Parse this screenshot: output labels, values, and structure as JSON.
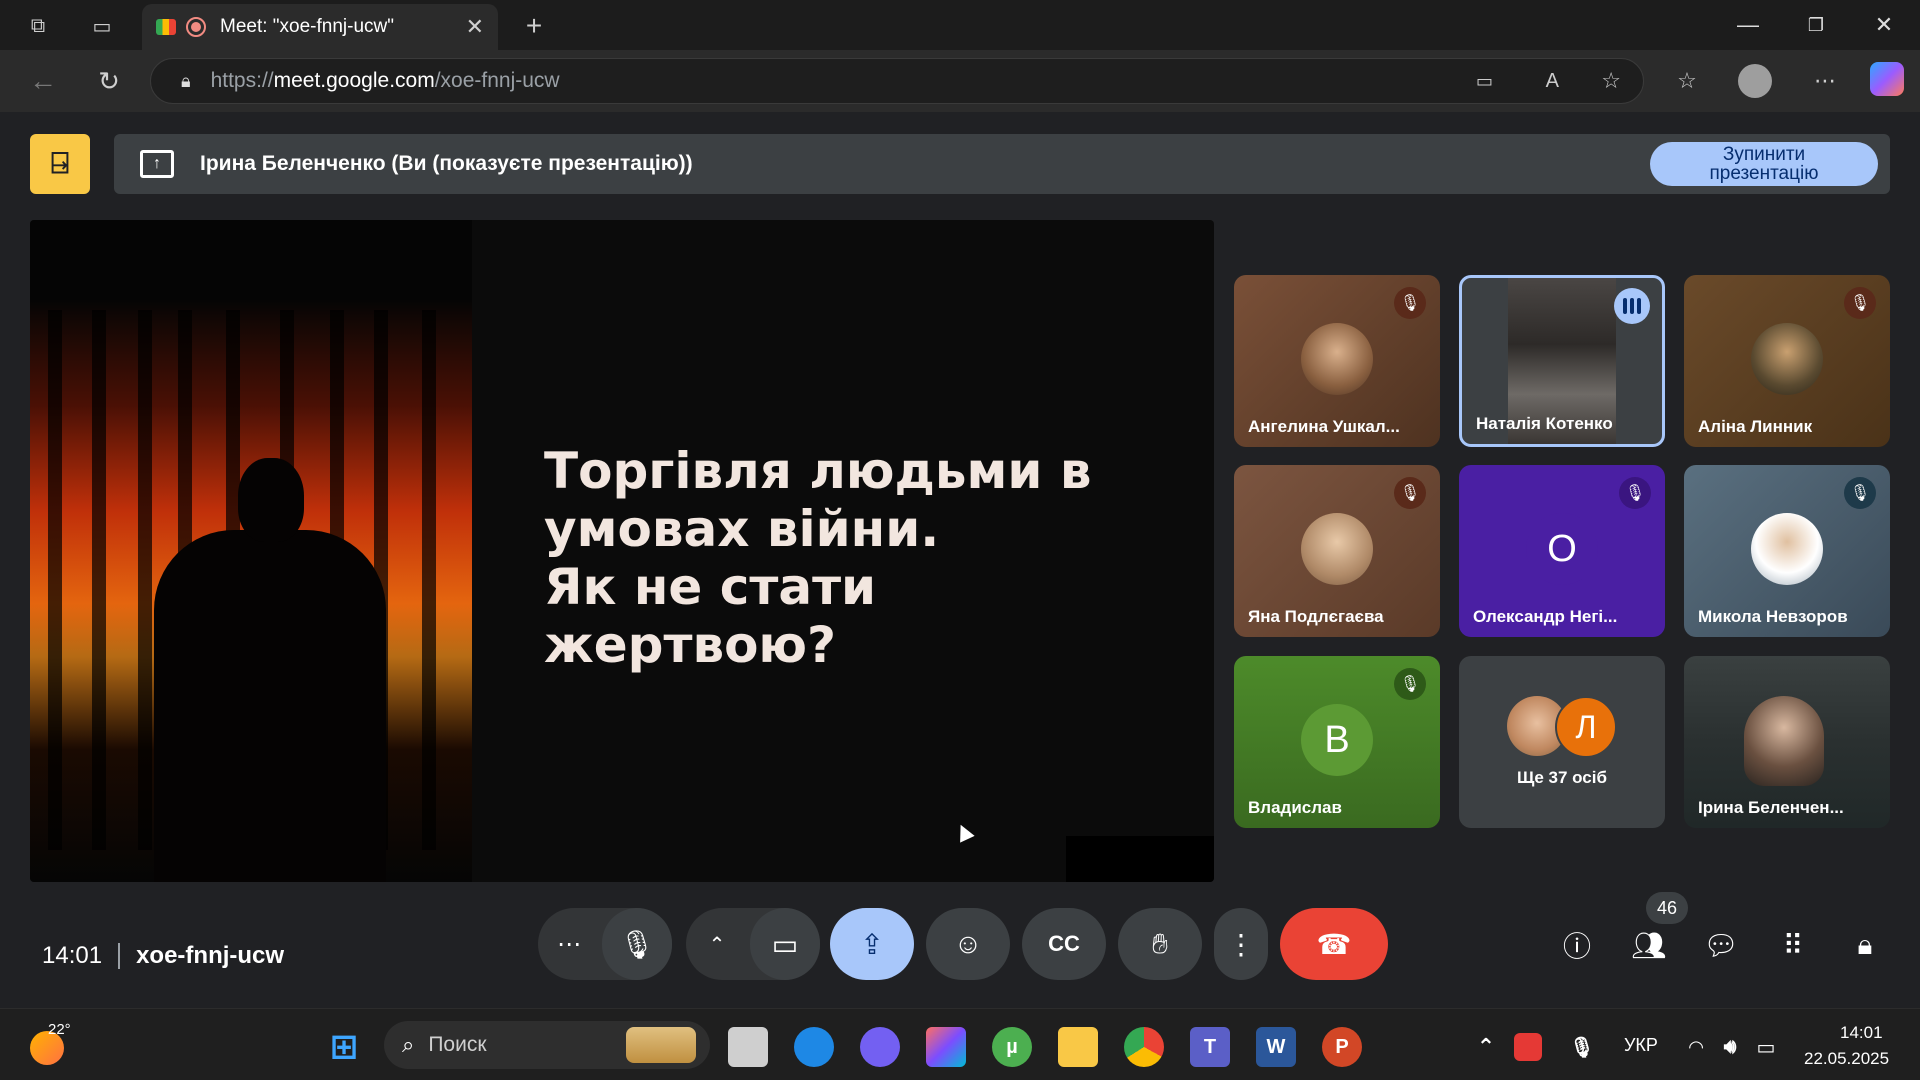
{
  "browser": {
    "tab_title": "Meet: \"xoe-fnnj-ucw\"",
    "url_domain": "meet.google.com",
    "url_prefix": "https://",
    "url_path": "/xoe-fnnj-ucw"
  },
  "meet": {
    "presenting_text": "Ірина Беленченко (Ви (показуєте презентацію))",
    "stop_presenting_label": "Зупинити презентацію",
    "slide": {
      "line1": "Торгівля людьми в",
      "line2": "умовах війни.",
      "line3": "Як не стати жертвою?"
    },
    "participants": [
      {
        "name": "Ангелина Ушкал...",
        "muted": true
      },
      {
        "name": "Наталія Котенко",
        "speaking": true
      },
      {
        "name": "Аліна Линник",
        "muted": true
      },
      {
        "name": "Яна Подлєгаєва",
        "muted": true
      },
      {
        "name": "Олександр Негі...",
        "initial": "О",
        "muted": true
      },
      {
        "name": "Микола Невзоров",
        "muted": true
      },
      {
        "name": "Владислав",
        "initial": "В",
        "muted": true
      },
      {
        "name": "Ще 37 осіб",
        "initial": "Л"
      },
      {
        "name": "Ірина Беленчен..."
      }
    ],
    "time": "14:01",
    "meeting_code": "xoe-fnnj-ucw",
    "participant_count": "46"
  },
  "taskbar": {
    "weather_temp": "22°",
    "search_placeholder": "Поиск",
    "language": "УКР",
    "clock_time": "14:01",
    "clock_date": "22.05.2025"
  },
  "colors": {
    "accent": "#a8c7fa",
    "end_call": "#ea4335",
    "tile_purple": "#4a1fa3",
    "tile_green": "#4d8b2a"
  }
}
